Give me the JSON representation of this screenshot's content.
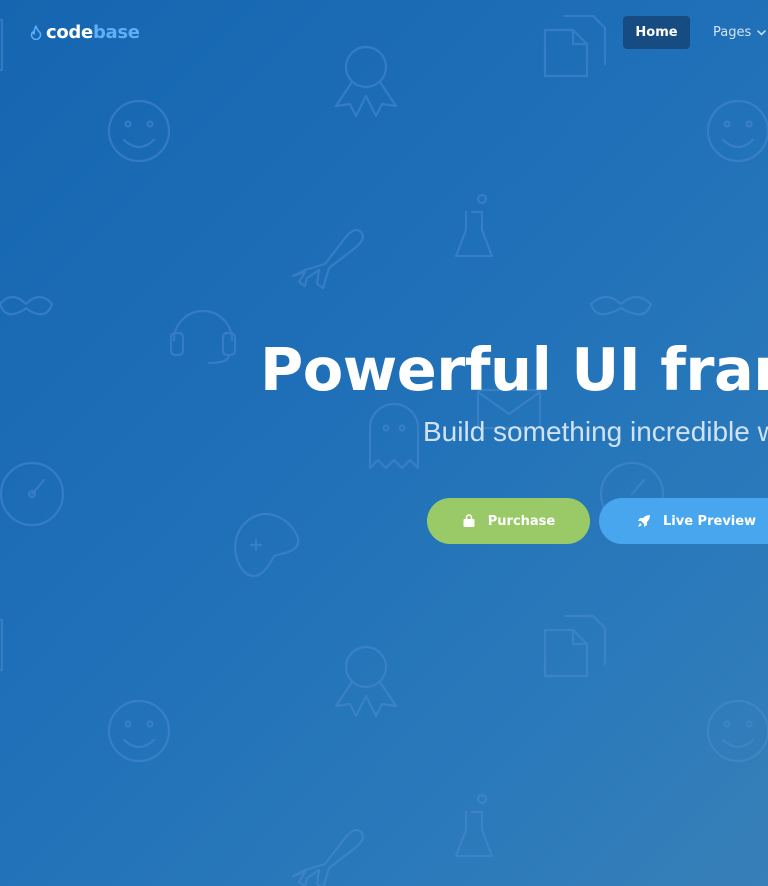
{
  "brand": {
    "part1": "code",
    "part2": "base"
  },
  "nav": {
    "home": "Home",
    "pages": "Pages"
  },
  "hero": {
    "title": "Powerful UI framework for startups",
    "subtitle": "Build something incredible with Codebase"
  },
  "buttons": {
    "purchase": "Purchase",
    "preview": "Live Preview"
  },
  "colors": {
    "background": "#1a6ab3",
    "nav_active": "#174c83",
    "purchase": "#9aca68",
    "preview": "#48a6ef",
    "brand_accent": "#5db0f5"
  },
  "icons": [
    "flame-icon",
    "chevron-down-icon",
    "shopping-bag-icon",
    "rocket-icon"
  ]
}
